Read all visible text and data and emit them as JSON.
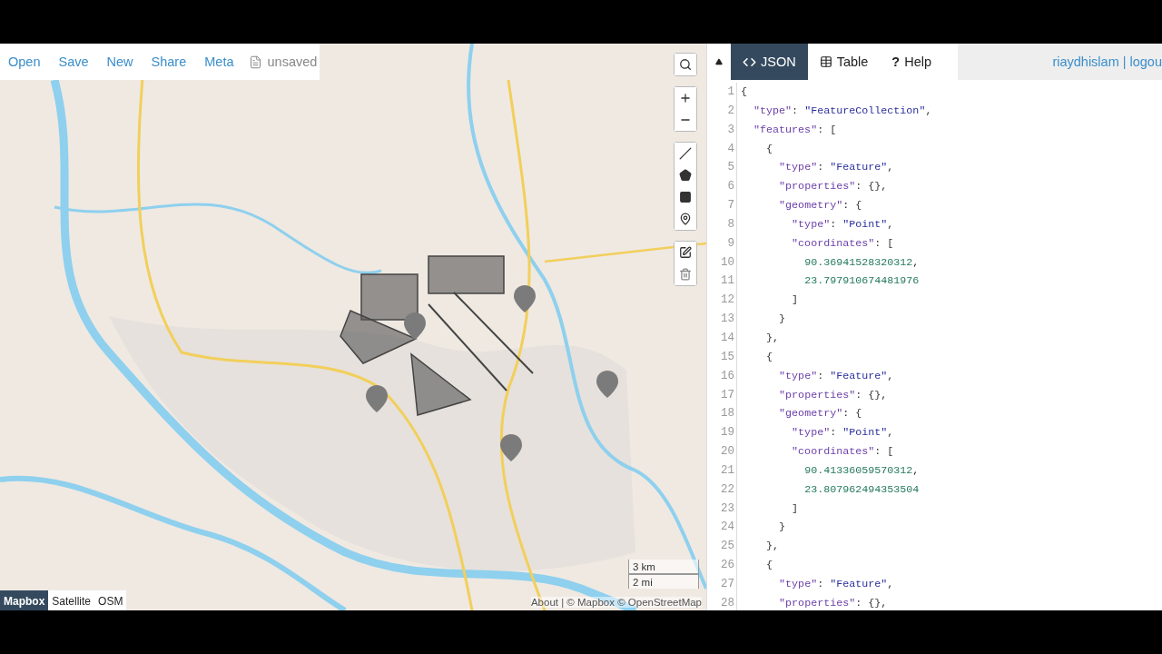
{
  "toolbar": {
    "links": [
      "Open",
      "Save",
      "New",
      "Share",
      "Meta"
    ],
    "file_status": "unsaved"
  },
  "map": {
    "kind": "picture",
    "control_groups": [
      [
        {
          "kind": "search"
        }
      ],
      [
        {
          "kind": "zoom-in"
        },
        {
          "kind": "zoom-out"
        }
      ],
      [
        {
          "kind": "line"
        },
        {
          "kind": "polygon"
        },
        {
          "kind": "rectangle"
        },
        {
          "kind": "marker"
        }
      ],
      [
        {
          "kind": "edit"
        },
        {
          "kind": "delete"
        }
      ]
    ],
    "layers": [
      {
        "label": "Mapbox",
        "selected": true
      },
      {
        "label": "Satellite",
        "selected": false
      },
      {
        "label": "OSM",
        "selected": false
      }
    ],
    "scale": [
      "3 km",
      "2 mi"
    ],
    "attribution": "About | © Mapbox © OpenStreetMap"
  },
  "panel": {
    "tabs": [
      {
        "kind": "code",
        "label": "JSON",
        "selected": true
      },
      {
        "kind": "table",
        "label": "Table",
        "selected": false
      },
      {
        "kind": "help",
        "glyph": "?",
        "label": "Help",
        "selected": false
      }
    ],
    "user": {
      "name": "riaydhislam",
      "separator": "|",
      "logout": "logou"
    },
    "lines": [
      {
        "n": "1",
        "kind": "open",
        "tokens": [
          {
            "kind": "p",
            "text": "{"
          }
        ]
      },
      {
        "n": "2",
        "kind": "plain",
        "tokens": [
          {
            "kind": "k",
            "text": "\"type\""
          },
          {
            "kind": "p",
            "text": ": "
          },
          {
            "kind": "s",
            "text": "\"FeatureCollection\""
          },
          {
            "kind": "p",
            "text": ","
          }
        ]
      },
      {
        "n": "3",
        "kind": "open",
        "tokens": [
          {
            "kind": "k",
            "text": "\"features\""
          },
          {
            "kind": "p",
            "text": ": ["
          }
        ]
      },
      {
        "n": "4",
        "kind": "open",
        "tokens": [
          {
            "kind": "p",
            "text": "{"
          }
        ]
      },
      {
        "n": "5",
        "kind": "plain",
        "tokens": [
          {
            "kind": "k",
            "text": "\"type\""
          },
          {
            "kind": "p",
            "text": ": "
          },
          {
            "kind": "s",
            "text": "\"Feature\""
          },
          {
            "kind": "p",
            "text": ","
          }
        ]
      },
      {
        "n": "6",
        "kind": "plain",
        "tokens": [
          {
            "kind": "k",
            "text": "\"properties\""
          },
          {
            "kind": "p",
            "text": ": {},"
          }
        ]
      },
      {
        "n": "7",
        "kind": "open",
        "tokens": [
          {
            "kind": "k",
            "text": "\"geometry\""
          },
          {
            "kind": "p",
            "text": ": {"
          }
        ]
      },
      {
        "n": "8",
        "kind": "plain",
        "tokens": [
          {
            "kind": "k",
            "text": "\"type\""
          },
          {
            "kind": "p",
            "text": ": "
          },
          {
            "kind": "s",
            "text": "\"Point\""
          },
          {
            "kind": "p",
            "text": ","
          }
        ]
      },
      {
        "n": "9",
        "kind": "open",
        "tokens": [
          {
            "kind": "k",
            "text": "\"coordinates\""
          },
          {
            "kind": "p",
            "text": ": ["
          }
        ]
      },
      {
        "n": "10",
        "kind": "plain",
        "tokens": [
          {
            "kind": "n",
            "text": "90.36941528320312"
          },
          {
            "kind": "p",
            "text": ","
          }
        ]
      },
      {
        "n": "11",
        "kind": "plain",
        "tokens": [
          {
            "kind": "n",
            "text": "23.797910674481976"
          }
        ]
      },
      {
        "n": "12",
        "kind": "close",
        "tokens": [
          {
            "kind": "p",
            "text": "]"
          }
        ]
      },
      {
        "n": "13",
        "kind": "close",
        "tokens": [
          {
            "kind": "p",
            "text": "}"
          }
        ]
      },
      {
        "n": "14",
        "kind": "close",
        "tokens": [
          {
            "kind": "p",
            "text": "},"
          }
        ]
      },
      {
        "n": "15",
        "kind": "open",
        "tokens": [
          {
            "kind": "p",
            "text": "{"
          }
        ]
      },
      {
        "n": "16",
        "kind": "plain",
        "tokens": [
          {
            "kind": "k",
            "text": "\"type\""
          },
          {
            "kind": "p",
            "text": ": "
          },
          {
            "kind": "s",
            "text": "\"Feature\""
          },
          {
            "kind": "p",
            "text": ","
          }
        ]
      },
      {
        "n": "17",
        "kind": "plain",
        "tokens": [
          {
            "kind": "k",
            "text": "\"properties\""
          },
          {
            "kind": "p",
            "text": ": {},"
          }
        ]
      },
      {
        "n": "18",
        "kind": "open",
        "tokens": [
          {
            "kind": "k",
            "text": "\"geometry\""
          },
          {
            "kind": "p",
            "text": ": {"
          }
        ]
      },
      {
        "n": "19",
        "kind": "plain",
        "tokens": [
          {
            "kind": "k",
            "text": "\"type\""
          },
          {
            "kind": "p",
            "text": ": "
          },
          {
            "kind": "s",
            "text": "\"Point\""
          },
          {
            "kind": "p",
            "text": ","
          }
        ]
      },
      {
        "n": "20",
        "kind": "open",
        "tokens": [
          {
            "kind": "k",
            "text": "\"coordinates\""
          },
          {
            "kind": "p",
            "text": ": ["
          }
        ]
      },
      {
        "n": "21",
        "kind": "plain",
        "tokens": [
          {
            "kind": "n",
            "text": "90.41336059570312"
          },
          {
            "kind": "p",
            "text": ","
          }
        ]
      },
      {
        "n": "22",
        "kind": "plain",
        "tokens": [
          {
            "kind": "n",
            "text": "23.807962494353504"
          }
        ]
      },
      {
        "n": "23",
        "kind": "close",
        "tokens": [
          {
            "kind": "p",
            "text": "]"
          }
        ]
      },
      {
        "n": "24",
        "kind": "close",
        "tokens": [
          {
            "kind": "p",
            "text": "}"
          }
        ]
      },
      {
        "n": "25",
        "kind": "close",
        "tokens": [
          {
            "kind": "p",
            "text": "},"
          }
        ]
      },
      {
        "n": "26",
        "kind": "open",
        "tokens": [
          {
            "kind": "p",
            "text": "{"
          }
        ]
      },
      {
        "n": "27",
        "kind": "plain",
        "tokens": [
          {
            "kind": "k",
            "text": "\"type\""
          },
          {
            "kind": "p",
            "text": ": "
          },
          {
            "kind": "s",
            "text": "\"Feature\""
          },
          {
            "kind": "p",
            "text": ","
          }
        ]
      },
      {
        "n": "28",
        "kind": "plain",
        "tokens": [
          {
            "kind": "k",
            "text": "\"properties\""
          },
          {
            "kind": "p",
            "text": ": {},"
          }
        ]
      }
    ]
  }
}
